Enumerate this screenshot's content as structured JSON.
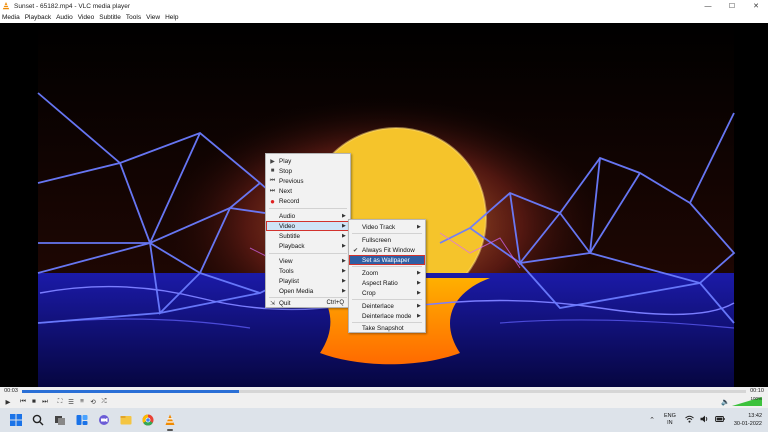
{
  "window": {
    "title": "Sunset - 65182.mp4 - VLC media player",
    "minimize": "—",
    "maximize": "☐",
    "close": "✕"
  },
  "menubar": [
    "Media",
    "Playback",
    "Audio",
    "Video",
    "Subtitle",
    "Tools",
    "View",
    "Help"
  ],
  "player": {
    "elapsed": "00:03",
    "total": "00:10",
    "progress": 0.3,
    "volume": "100%",
    "volume_level": 1.0
  },
  "colors": {
    "accent": "#2a6fd6",
    "highlight": "#d2322d",
    "sun": "#f5c42b",
    "neon": "#5a6dff"
  },
  "context_menu": {
    "play": "Play",
    "stop": "Stop",
    "previous": "Previous",
    "next": "Next",
    "record": "Record",
    "audio": "Audio",
    "video": "Video",
    "subtitle": "Subtitle",
    "playback": "Playback",
    "view": "View",
    "tools": "Tools",
    "playlist": "Playlist",
    "open_media": "Open Media",
    "quit": "Quit",
    "quit_shortcut": "Ctrl+Q"
  },
  "video_submenu": {
    "video_track": "Video Track",
    "fullscreen": "Fullscreen",
    "always_fit": "Always Fit Window",
    "set_wallpaper": "Set as Wallpaper",
    "zoom": "Zoom",
    "aspect_ratio": "Aspect Ratio",
    "crop": "Crop",
    "deinterlace": "Deinterlace",
    "deinterlace_mode": "Deinterlace mode",
    "take_snapshot": "Take Snapshot"
  },
  "taskbar": {
    "lang_top": "ENG",
    "lang_bottom": "IN",
    "time": "13:42",
    "date": "30-01-2022"
  }
}
